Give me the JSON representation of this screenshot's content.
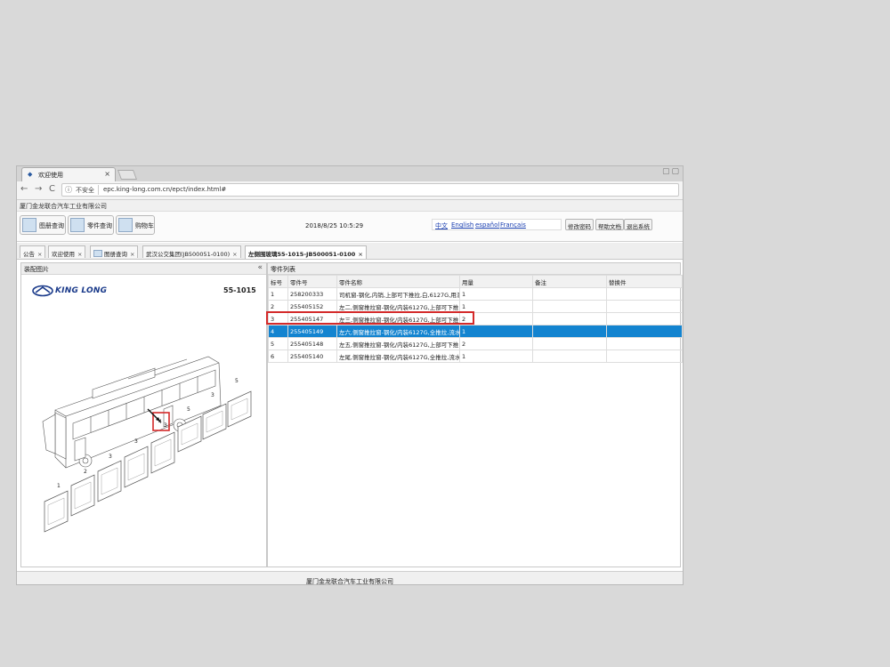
{
  "browser": {
    "tab_title": "欢迎使用",
    "tab_close": "×",
    "security_label": "不安全",
    "url": "epc.king-long.com.cn/epct/index.html#",
    "nav_back": "←",
    "nav_forward": "→",
    "nav_reload": "C",
    "info_icon": "ⓘ"
  },
  "header": {
    "company": "厦门金龙联合汽车工业有限公司"
  },
  "toolbar": {
    "buttons": [
      "图册查询",
      "零件查询",
      "购物车"
    ],
    "datetime": "2018/8/25 10:5:29",
    "languages": [
      "中文",
      "English",
      "español",
      "Français"
    ],
    "actions": [
      "修改密码",
      "帮助文档",
      "退出系统"
    ]
  },
  "app_tabs": [
    "公告",
    "欢迎使用",
    "图册查询",
    "武汉公交集团(JB500051-0100)",
    "左侧围玻璃55-1015-JB500051-0100"
  ],
  "left_panel": {
    "title": "装配图片",
    "collapse": "«",
    "logo": "KING LONG",
    "code": "55-1015",
    "callouts": [
      "1",
      "2",
      "3",
      "3",
      "3",
      "4",
      "5",
      "3",
      "5"
    ]
  },
  "right_panel": {
    "title": "零件列表",
    "columns": [
      "标号",
      "零件号",
      "零件名称",
      "用量",
      "备注",
      "替换件"
    ],
    "rows": [
      [
        "1",
        "258200333",
        "司机窗-钢化,内销,上部可下推拉,白,6127G,用汇",
        "1",
        "",
        ""
      ],
      [
        "2",
        "255405152",
        "左二,侧窗推拉窗-钢化/内装6127G,上部可下推",
        "1",
        "",
        ""
      ],
      [
        "3",
        "255405147",
        "左三,侧窗推拉窗-钢化/内装6127G,上部可下推",
        "2",
        "",
        ""
      ],
      [
        "4",
        "255405149",
        "左六,侧窗推拉窗-钢化/内装6127G,全推拉,流水",
        "1",
        "",
        ""
      ],
      [
        "5",
        "255405148",
        "左五,侧窗推拉窗-钢化/内装6127G,上部可下推",
        "2",
        "",
        ""
      ],
      [
        "6",
        "255405140",
        "左尾,侧窗推拉窗-钢化/内装6127G,全推拉,流水",
        "1",
        "",
        ""
      ]
    ],
    "selected_row": 3
  },
  "footer": {
    "text": "厦门金龙联合汽车工业有限公司"
  },
  "colors": {
    "selected_row": "#1384d0",
    "highlight_box": "#d42a2a",
    "link": "#1a3fb0",
    "logo": "#1a3a8a"
  }
}
